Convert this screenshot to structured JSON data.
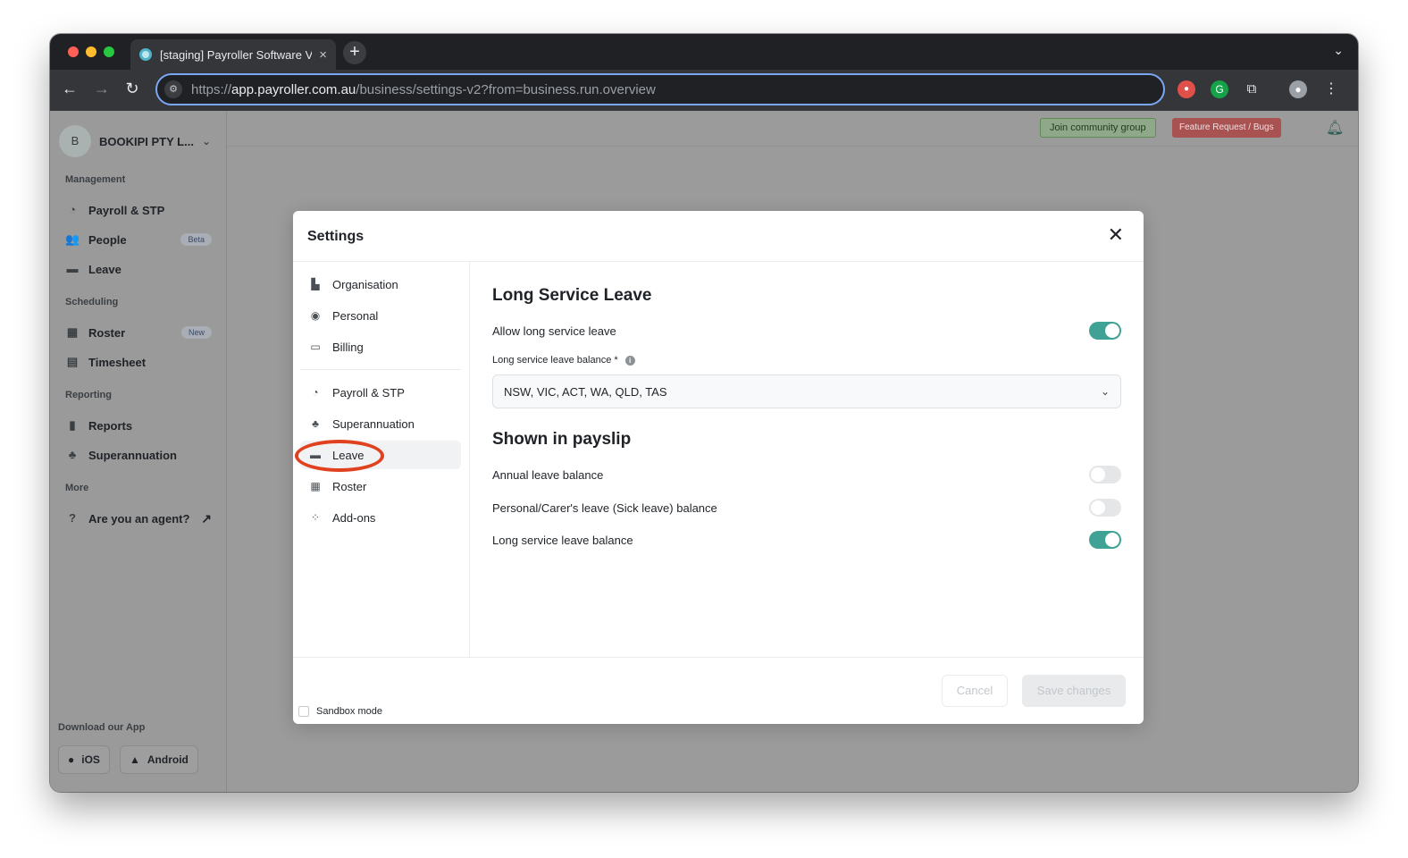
{
  "browser": {
    "tab_title": "[staging] Payroller Software V",
    "tab_close": "×",
    "new_tab": "+",
    "tab_menu": "⌄",
    "url_prefix": "https://",
    "url_host": "app.payroller.com.au",
    "url_path": "/business/settings-v2?from=business.run.overview",
    "back": "←",
    "forward": "→",
    "reload": "↻",
    "menu": "⋮",
    "ext_grammarly": "G"
  },
  "sidebar": {
    "org_initial": "B",
    "org_name": "BOOKIPI PTY L...",
    "org_chevron": "⌄",
    "management_label": "Management",
    "scheduling_label": "Scheduling",
    "reporting_label": "Reporting",
    "more_label": "More",
    "items": [
      {
        "label": "Payroll & STP"
      },
      {
        "label": "People",
        "badge": "Beta"
      },
      {
        "label": "Leave"
      },
      {
        "label": "Roster",
        "badge": "New"
      },
      {
        "label": "Timesheet"
      },
      {
        "label": "Reports"
      },
      {
        "label": "Superannuation"
      },
      {
        "label": "Are you an agent?",
        "trailing_icon": "↗"
      }
    ],
    "download_label": "Download our App",
    "ios_label": "iOS",
    "android_label": "Android"
  },
  "topbar": {
    "join_label": "Join community group",
    "feature_label": "Feature Request / Bugs"
  },
  "modal": {
    "title": "Settings",
    "close": "✕",
    "menu": [
      {
        "label": "Organisation"
      },
      {
        "label": "Personal"
      },
      {
        "label": "Billing"
      },
      {
        "label": "Payroll & STP"
      },
      {
        "label": "Superannuation"
      },
      {
        "label": "Leave",
        "active": true
      },
      {
        "label": "Roster"
      },
      {
        "label": "Add-ons"
      }
    ],
    "lsl_heading": "Long Service Leave",
    "allow_lsl_label": "Allow long service leave",
    "allow_lsl_on": true,
    "balance_label": "Long service leave balance *",
    "balance_info": "i",
    "balance_value": "NSW, VIC, ACT, WA, QLD, TAS",
    "payslip_heading": "Shown in payslip",
    "payslip_rows": [
      {
        "label": "Annual leave balance",
        "on": false
      },
      {
        "label": "Personal/Carer's leave (Sick leave) balance",
        "on": false
      },
      {
        "label": "Long service leave balance",
        "on": true
      }
    ],
    "sandbox_label": "Sandbox mode",
    "cancel_label": "Cancel",
    "save_label": "Save changes"
  },
  "colors": {
    "toggle_on": "#3fa295",
    "highlight_ring": "#e0421f"
  }
}
